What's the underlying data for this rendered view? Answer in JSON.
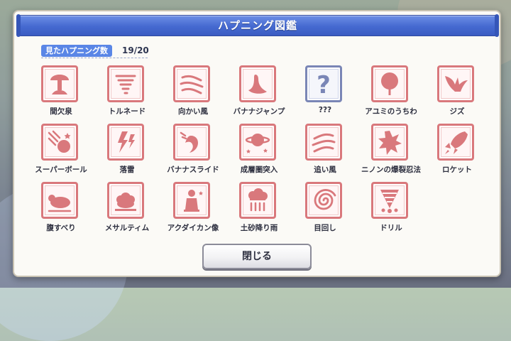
{
  "dialog": {
    "title": "ハプニング図鑑",
    "seen_label": "見たハプニング数",
    "seen_count": "19/20",
    "close_label": "閉じる"
  },
  "items": [
    {
      "label": "間欠泉",
      "icon": "geyser-icon"
    },
    {
      "label": "トルネード",
      "icon": "tornado-icon"
    },
    {
      "label": "向かい風",
      "icon": "headwind-icon"
    },
    {
      "label": "バナナジャンプ",
      "icon": "banana-jump-icon"
    },
    {
      "label": "???",
      "icon": "question-mark-icon"
    },
    {
      "label": "アユミのうちわ",
      "icon": "fan-icon"
    },
    {
      "label": "ジズ",
      "icon": "ziz-bird-icon"
    },
    {
      "label": "スーパーボール",
      "icon": "super-ball-icon"
    },
    {
      "label": "落雷",
      "icon": "lightning-icon"
    },
    {
      "label": "バナナスライド",
      "icon": "banana-slide-icon"
    },
    {
      "label": "成層圏突入",
      "icon": "planet-icon"
    },
    {
      "label": "追い風",
      "icon": "tailwind-icon"
    },
    {
      "label": "ニノンの爆裂忍法",
      "icon": "explosion-icon"
    },
    {
      "label": "ロケット",
      "icon": "rocket-icon"
    },
    {
      "label": "腹すべり",
      "icon": "belly-slide-icon"
    },
    {
      "label": "メサルティム",
      "icon": "sheep-icon"
    },
    {
      "label": "アクダイカン像",
      "icon": "statue-icon"
    },
    {
      "label": "土砂降り雨",
      "icon": "rain-cloud-icon"
    },
    {
      "label": "目回し",
      "icon": "spiral-icon"
    },
    {
      "label": "ドリル",
      "icon": "drill-icon"
    }
  ],
  "colors": {
    "stamp": "#d9787c",
    "unknown": "#7a86b6",
    "title_bar": "#4569d0"
  }
}
